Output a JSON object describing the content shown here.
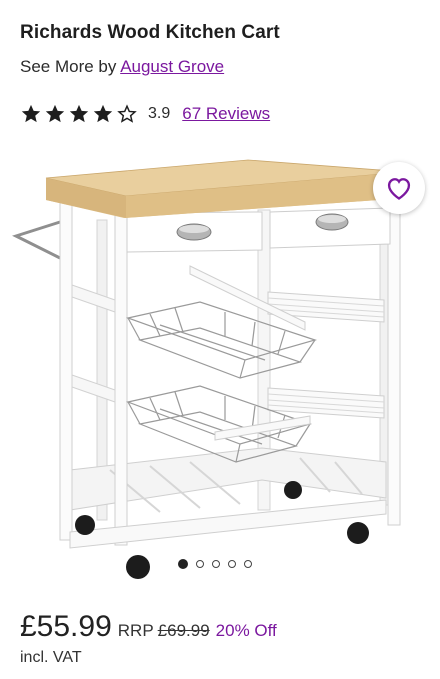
{
  "product": {
    "title": "Richards Wood Kitchen Cart",
    "see_more_prefix": "See More by",
    "brand": "August Grove",
    "rating": "3.9",
    "reviews_label": "67 Reviews",
    "stars_filled": 4,
    "stars_total": 5
  },
  "pricing": {
    "price": "£55.99",
    "rrp_label": "RRP",
    "was_price": "£69.99",
    "discount": "20% Off",
    "vat_note": "incl. VAT"
  },
  "gallery": {
    "image_count": 5,
    "active_index": 0
  },
  "icons": {
    "favorite": "heart-icon",
    "star_filled": "star-filled-icon",
    "star_empty": "star-outline-icon"
  },
  "colors": {
    "accent": "#7b189f",
    "wood_top": "#e2c48e",
    "cart_white": "#ffffff"
  }
}
